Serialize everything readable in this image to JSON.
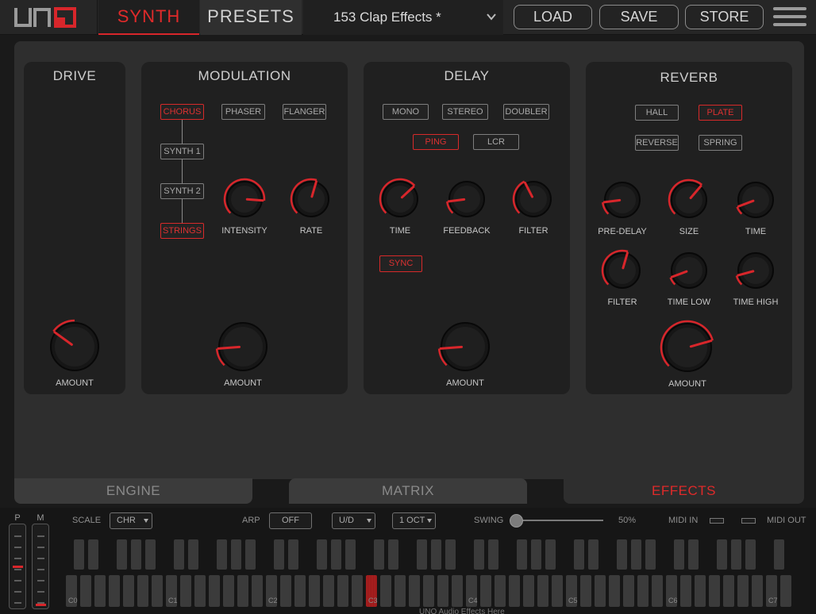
{
  "header": {
    "tabs": [
      "SYNTH",
      "PRESETS"
    ],
    "preset_name": "153 Clap Effects *",
    "buttons": {
      "load": "LOAD",
      "save": "SAVE",
      "store": "STORE"
    }
  },
  "panels": {
    "drive": {
      "title": "DRIVE",
      "amount_label": "AMOUNT"
    },
    "modulation": {
      "title": "MODULATION",
      "modes": [
        "CHORUS",
        "PHASER",
        "FLANGER"
      ],
      "active_mode": "CHORUS",
      "voices": [
        "SYNTH 1",
        "SYNTH 2",
        "STRINGS"
      ],
      "active_voice": "STRINGS",
      "knobs": [
        "INTENSITY",
        "RATE"
      ],
      "amount_label": "AMOUNT"
    },
    "delay": {
      "title": "DELAY",
      "modes": [
        "MONO",
        "STEREO",
        "DOUBLER",
        "PING",
        "LCR"
      ],
      "active_mode": "PING",
      "knobs": [
        "TIME",
        "FEEDBACK",
        "FILTER"
      ],
      "sync_label": "SYNC",
      "amount_label": "AMOUNT"
    },
    "reverb": {
      "title": "REVERB",
      "modes": [
        "HALL",
        "PLATE",
        "REVERSE",
        "SPRING"
      ],
      "active_mode": "PLATE",
      "knobs_row1": [
        "PRE-DELAY",
        "SIZE",
        "TIME"
      ],
      "knobs_row2": [
        "FILTER",
        "TIME LOW",
        "TIME HIGH"
      ],
      "amount_label": "AMOUNT"
    }
  },
  "bottom_tabs": [
    "ENGINE",
    "MATRIX",
    "EFFECTS"
  ],
  "keyboard_bar": {
    "p_label": "P",
    "m_label": "M",
    "scale_label": "SCALE",
    "scale_value": "CHR",
    "arp_label": "ARP",
    "arp_value": "OFF",
    "arp_mode": "U/D",
    "arp_octave": "1 OCT",
    "swing_label": "SWING",
    "swing_value": "50%",
    "midi_in": "MIDI IN",
    "midi_out": "MIDI OUT",
    "octaves": [
      "C0",
      "C1",
      "C2",
      "C3",
      "C4",
      "C5",
      "C6",
      "C7"
    ],
    "highlighted_key": "C3",
    "footer": "UNO Audio Effects Here"
  },
  "colors": {
    "accent": "#d8262b",
    "panel": "#202020",
    "background": "#2e2e2e"
  }
}
